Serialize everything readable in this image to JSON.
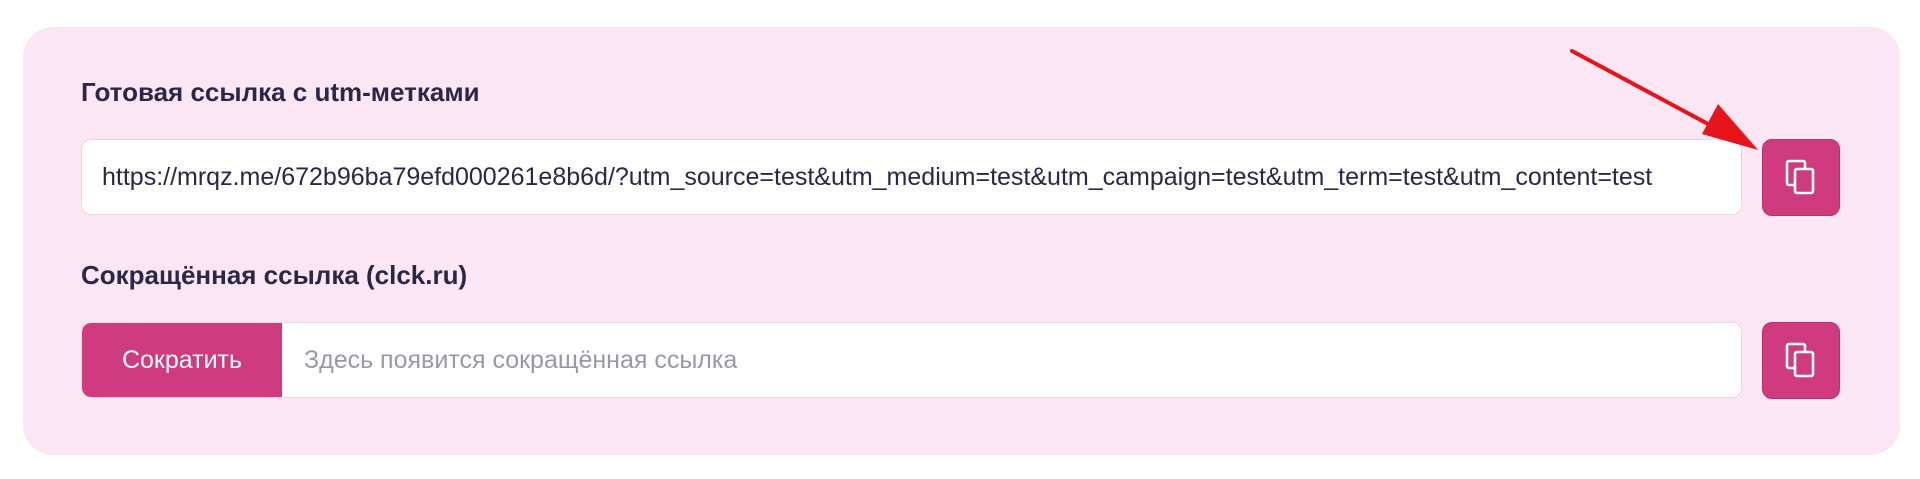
{
  "full_link": {
    "label": "Готовая ссылка с utm-метками",
    "value": "https://mrqz.me/672b96ba79efd000261e8b6d/?utm_source=test&utm_medium=test&utm_campaign=test&utm_term=test&utm_content=test",
    "copy_icon": "copy-icon"
  },
  "short_link": {
    "label": "Сокращённая ссылка (clck.ru)",
    "shorten_label": "Сократить",
    "placeholder": "Здесь появится сокращённая ссылка",
    "copy_icon": "copy-icon"
  },
  "colors": {
    "card_background": "#fbe6f3",
    "accent": "#d03a7f",
    "text": "#2a2748",
    "annotation_arrow": "#e8141c"
  }
}
